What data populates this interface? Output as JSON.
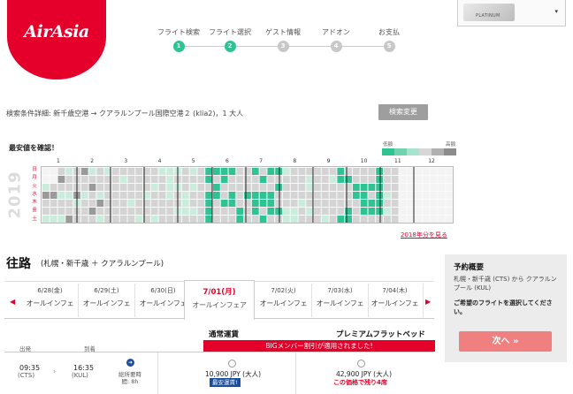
{
  "logo": {
    "text": "AirAsia"
  },
  "steps": [
    {
      "label": "フライト検索",
      "num": "1",
      "done": true
    },
    {
      "label": "フライト選択",
      "num": "2",
      "done": true
    },
    {
      "label": "ゲスト情報",
      "num": "3",
      "done": false
    },
    {
      "label": "アドオン",
      "num": "4",
      "done": false
    },
    {
      "label": "お支払",
      "num": "5",
      "done": false
    }
  ],
  "member": {
    "card_text": "PLATINUM",
    "caret": "▾"
  },
  "search": {
    "summary": "検索条件詳細: 新千歳空港 → クアラルンプール国際空港２ (klia2)，1 大人",
    "modify_label": "検索変更"
  },
  "calendar": {
    "title": "最安値を確認！",
    "legend_low": "低額",
    "legend_high": "高額",
    "legend_colors": [
      "#2fc293",
      "#6fd3ae",
      "#a8e4cd",
      "#d7d7d7",
      "#b0b0b0",
      "#8c8c8c"
    ],
    "year": "2019",
    "dow": [
      "日",
      "月",
      "火",
      "水",
      "木",
      "金",
      "土"
    ],
    "months": [
      "1",
      "2",
      "3",
      "4",
      "5",
      "6",
      "7",
      "8",
      "9",
      "10",
      "11",
      "12"
    ],
    "link_label": "2018年分を見る",
    "colors": {
      "green": "#2fc293",
      "pale": "#c9ecdd",
      "grey": "#d4d4d4",
      "dark": "#9a9a9a",
      "empty": "#f4f4f4"
    }
  },
  "route": {
    "title": "往路",
    "subtitle": "(札幌・新千歳 ＋ クアラルンプール)"
  },
  "date_tabs": [
    {
      "date": "6/28(金)",
      "price": "オールインフェ",
      "active": false
    },
    {
      "date": "6/29(土)",
      "price": "オールインフェ",
      "active": false
    },
    {
      "date": "6/30(日)",
      "price": "オールインフェ",
      "active": false
    },
    {
      "date": "7/01(月)",
      "price": "オールインフェア",
      "active": true
    },
    {
      "date": "7/02(火)",
      "price": "オールインフェ",
      "active": false
    },
    {
      "date": "7/03(水)",
      "price": "オールインフェ",
      "active": false
    },
    {
      "date": "7/04(木)",
      "price": "オールインフェ",
      "active": false
    }
  ],
  "fares": {
    "col1_title": "通常運賃",
    "col2_title": "プレミアムフラットベッド",
    "banner": "BIGメンバー割引が適用されました!",
    "header_depart": "出発",
    "header_arrive": "到着"
  },
  "flight": {
    "dep_time": "09:35",
    "dep_code": "(CTS)",
    "sep": "›",
    "arr_time": "16:35",
    "arr_code": "(KUL)",
    "duration": "総所要時間: 8h",
    "fare1": "10,900 JPY (大人)",
    "fare1_badge": "最安運賃!",
    "fare2": "42,900 JPY (大人)",
    "fare2_note": "この価格で残り4席"
  },
  "summary_panel": {
    "title": "予約概要",
    "text": "札幌・新千歳 (CTS) から クアラルンプール (KUL)",
    "note": "ご希望のフライトを選択してください。",
    "next_label": "次へ »"
  }
}
